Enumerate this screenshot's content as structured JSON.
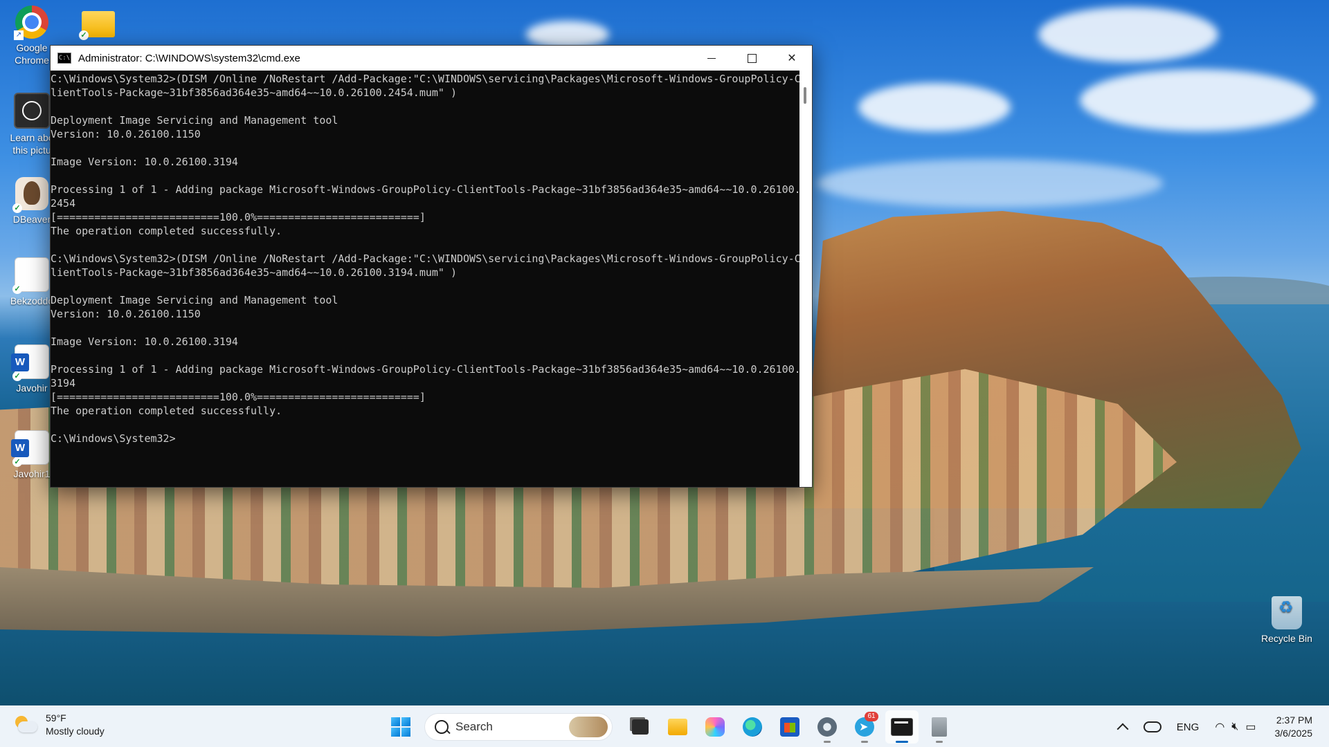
{
  "desktop": {
    "icons": [
      {
        "label": "Google\nChrome"
      },
      {
        "label": ""
      },
      {
        "label": "Learn abo\nthis pictu"
      },
      {
        "label": "DBeaver"
      },
      {
        "label": "Bekzoddo"
      },
      {
        "label": "Javohir"
      },
      {
        "label": "Javohir1"
      },
      {
        "label": "Recycle Bin"
      }
    ]
  },
  "cmd": {
    "title": "Administrator: C:\\WINDOWS\\system32\\cmd.exe",
    "lines": [
      "C:\\Windows\\System32>(DISM /Online /NoRestart /Add-Package:\"C:\\WINDOWS\\servicing\\Packages\\Microsoft-Windows-GroupPolicy-C",
      "lientTools-Package~31bf3856ad364e35~amd64~~10.0.26100.2454.mum\" )",
      "",
      "Deployment Image Servicing and Management tool",
      "Version: 10.0.26100.1150",
      "",
      "Image Version: 10.0.26100.3194",
      "",
      "Processing 1 of 1 - Adding package Microsoft-Windows-GroupPolicy-ClientTools-Package~31bf3856ad364e35~amd64~~10.0.26100.",
      "2454",
      "[==========================100.0%==========================]",
      "The operation completed successfully.",
      "",
      "C:\\Windows\\System32>(DISM /Online /NoRestart /Add-Package:\"C:\\WINDOWS\\servicing\\Packages\\Microsoft-Windows-GroupPolicy-C",
      "lientTools-Package~31bf3856ad364e35~amd64~~10.0.26100.3194.mum\" )",
      "",
      "Deployment Image Servicing and Management tool",
      "Version: 10.0.26100.1150",
      "",
      "Image Version: 10.0.26100.3194",
      "",
      "Processing 1 of 1 - Adding package Microsoft-Windows-GroupPolicy-ClientTools-Package~31bf3856ad364e35~amd64~~10.0.26100.",
      "3194",
      "[==========================100.0%==========================]",
      "The operation completed successfully.",
      "",
      "C:\\Windows\\System32>"
    ]
  },
  "taskbar": {
    "weather": {
      "temp": "59°F",
      "condition": "Mostly cloudy"
    },
    "search_label": "Search",
    "telegram_badge": "61",
    "tray": {
      "language": "ENG",
      "time": "2:37 PM",
      "date": "3/6/2025"
    }
  }
}
